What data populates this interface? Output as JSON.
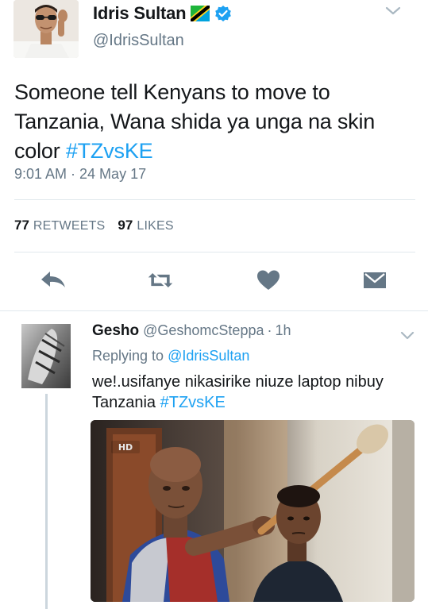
{
  "tweet": {
    "display_name": "Idris Sultan",
    "handle": "@IdrisSultan",
    "text_main": "Someone tell Kenyans to move to Tanzania, Wana shida ya unga na skin color ",
    "hashtag": "#TZvsKE",
    "timestamp": "9:01 AM · 24 May 17",
    "retweets_count": "77",
    "retweets_label": "RETWEETS",
    "likes_count": "97",
    "likes_label": "LIKES",
    "icons": [
      "reply-icon",
      "retweet-icon",
      "like-icon",
      "direct-message-icon",
      "verified-badge-icon",
      "tanzania-flag-icon",
      "chevron-down-icon"
    ]
  },
  "reply": {
    "display_name": "Gesho",
    "handle": "@GeshomcSteppa",
    "separator": "·",
    "time": "1h",
    "replying_prefix": "Replying to ",
    "replying_mention": "@IdrisSultan",
    "text_main": "we!.usifanye nikasirike niuze laptop nibuy Tanzania ",
    "hashtag": "#TZvsKE",
    "media_watermark": "HD"
  },
  "colors": {
    "link": "#1da1f2",
    "secondary_text": "#657786",
    "primary_text": "#14171a",
    "icon_gray": "#657786",
    "divider": "#e1e8ed",
    "verified": "#1da1f2"
  }
}
